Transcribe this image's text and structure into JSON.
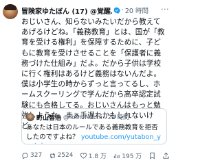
{
  "tweet": {
    "author_name": "冒険家ゆたぼん (17) @覚醒…",
    "separator": "·",
    "time": "20 時間",
    "more": "···",
    "body": "おじいさん、知らないみたいだから教えてあげるけどね。「義務教育」とは、国が「教育を受ける権利」を保障するために、子どもに教育を受けさせることを「保護者に義務づけた仕組み」だよ。だから子供は学校に行く権利はあるけど義務はないんだよ。僕は小学生の時からずっと言ってるし、ホームスクーリングで学んだから高卒認定試験にも合格してる。おじいさんはもっと勉強しような。まぁ手遅れかもしれないけど。"
  },
  "quote": {
    "author_name": "町山智浩",
    "handle": "@TomoMachi · 22 時間",
    "text_line1": "あなたは日本のルールである義務教育を拒否",
    "text_line2_prefix": "したのですよね？ ",
    "link": "youtube.com/yutabon_youtub…"
  },
  "actions": {
    "reply_count": "327",
    "retweet_count": "2524",
    "like_count": "1.8 万",
    "views_count": "195 万"
  },
  "colors": {
    "link": "#1d9bf0",
    "verified": "#1d9bf0",
    "muted": "#536471"
  }
}
